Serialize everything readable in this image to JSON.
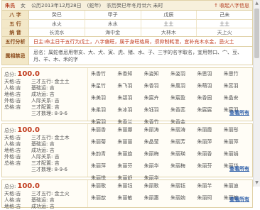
{
  "header": {
    "name": "朱氏",
    "gender": "女",
    "solar": "公历2013年12月28日",
    "shengxiao": "(蛇年)",
    "lunar": "农历癸巳年冬月廿六 未时",
    "collect_label": "收起八字信息"
  },
  "bazi": {
    "rows": [
      {
        "label": "八 字",
        "cells": [
          "癸巳",
          "甲子",
          "戊辰",
          "己未"
        ]
      },
      {
        "label": "五 行",
        "cells": [
          "水火",
          "木水",
          "土土",
          "土土"
        ]
      },
      {
        "label": "纳 音",
        "cells": [
          "长流水",
          "海中金",
          "大林木",
          "天上火"
        ]
      }
    ]
  },
  "wuxing": {
    "label": "五行分析",
    "text": "日主:命主日干五行为戊土，八字偏旺，属于身旺格局，须抑制耗泄，宜补充木水金，忌火土"
  },
  "bajie": {
    "label": "属相禁忌",
    "text": "忌名：属蛇者忌用带亥、大、犬、寅、虎、猪、水、子、三字的名字取名，宜用带口、宀、豆、月、羊、木、禾的字"
  },
  "cards": [
    {
      "score_label": "总分:",
      "score": "100.0",
      "rows": [
        {
          "a": "天格:吉",
          "b": "三才五行: 金土土"
        },
        {
          "a": "人格:吉",
          "b": "基础运: 吉"
        },
        {
          "a": "地格:吉",
          "b": "成功运: 吉"
        },
        {
          "a": "外格:吉",
          "b": "人际关系: 吉"
        },
        {
          "a": "总格:吉",
          "b": "三才配置: 吉"
        },
        {
          "a": "",
          "b": "三才数理: 8-9-6"
        }
      ],
      "names": [
        "朱香竹",
        "朱香知",
        "朱姿知",
        "朱姿羽",
        "朱思羽",
        "朱思竹",
        "朱星竹",
        "朱飞羽",
        "朱香羽",
        "朱風羽",
        "朱萌羽",
        "朱蕊羽",
        "朱美羽",
        "朱碧羽",
        "朱宸卉",
        "朱宸盈",
        "朱香园",
        "朱晶安",
        "朱柔羽",
        "朱冰羽",
        "朱钰羽",
        "朱香蕊",
        "朱宸宸",
        "朱宸羽",
        "朱宸羽",
        "朱香兰",
        "朱香竹",
        "朱香金"
      ],
      "see_all": "查看所有"
    },
    {
      "score_label": "总分:",
      "score": "100.0",
      "rows": [
        {
          "a": "天格:吉",
          "b": "三才五行: 金土木"
        },
        {
          "a": "人格:吉",
          "b": "基础运: 吉"
        },
        {
          "a": "地格:吉",
          "b": "成功运: 吉"
        },
        {
          "a": "外格:吉",
          "b": "人际关系: 吉"
        },
        {
          "a": "总格:吉",
          "b": "三才配置: 吉"
        },
        {
          "a": "",
          "b": "三才数理: 8-9-6"
        }
      ],
      "names": [
        "朱丽香",
        "朱丽娜",
        "朱丽涛",
        "朱丽涛",
        "朱丽霞",
        "朱丽彤",
        "朱丽菊",
        "朱丽丽",
        "朱晶莹",
        "朱丽芳",
        "朱丽萍",
        "朱丽萍",
        "朱韵青",
        "朱丽旋",
        "朱丽梅",
        "朱丽瑛",
        "朱丽香",
        "朱丽娟",
        "朱丽萍",
        "朱丽芬",
        "朱丽华",
        "朱丽梅",
        "朱丽芬",
        "朱丽华",
        "朱丽悦",
        "朱丽舒",
        "朱丽华"
      ],
      "see_all": "查看所有"
    },
    {
      "score_label": "总分:",
      "score": "100.0",
      "rows": [
        {
          "a": "天格:吉",
          "b": "三才五行: 金土火"
        },
        {
          "a": "人格:吉",
          "b": "基础运: 吉"
        },
        {
          "a": "地格:吉",
          "b": "成功运: 吉"
        }
      ],
      "names": [
        "朱丽歌",
        "朱丽钰",
        "朱丽歌",
        "朱丽钰",
        "朱丽芊",
        "朱丽迪",
        "朱丽歆",
        "朱丽敏",
        "朱丽惠",
        "朱丽婉",
        "朱丽珂",
        "朱丽敏"
      ],
      "see_all": "查看所有"
    }
  ]
}
